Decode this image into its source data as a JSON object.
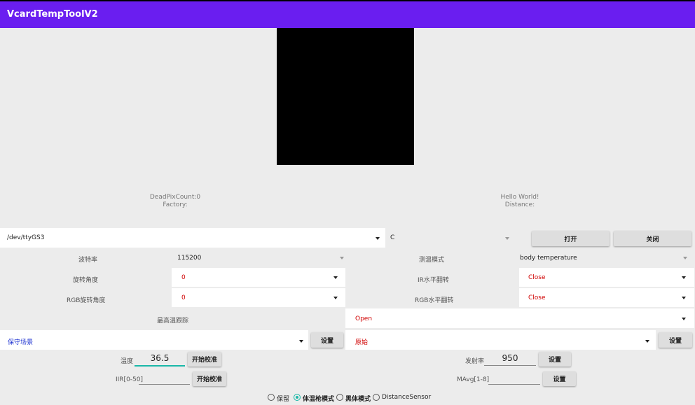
{
  "app": {
    "title": "VcardTempToolV2"
  },
  "status": {
    "dead_pix": "DeadPixCount:0",
    "factory": "Factory:",
    "hello": "Hello World!",
    "distance": "Distance:"
  },
  "serial": {
    "port": "/dev/ttyGS3",
    "unit": "C",
    "open_label": "打开",
    "close_label": "关闭"
  },
  "settings": {
    "baud_label": "波特率",
    "baud_value": "115200",
    "mode_label": "测温模式",
    "mode_value": "body temperature",
    "rotate_label": "旋转角度",
    "rotate_value": "0",
    "ir_flip_label": "IR水平翻转",
    "ir_flip_value": "Close",
    "rgb_rotate_label": "RGB旋转角度",
    "rgb_rotate_value": "0",
    "rgb_flip_label": "RGB水平翻转",
    "rgb_flip_value": "Close",
    "track_label": "最高温跟踪",
    "track_value": "Open"
  },
  "scene": {
    "value": "保守场景",
    "set_label": "设置"
  },
  "source": {
    "value": "原始",
    "set_label": "设置"
  },
  "calib": {
    "temp_label": "温度",
    "temp_value": "36.5",
    "start_label": "开始校准",
    "emis_label": "发射率",
    "emis_value": "950",
    "emis_set_label": "设置",
    "iir_label": "IIR[0-50]",
    "iir_start_label": "开始校准",
    "mavg_label": "MAvg[1-8]",
    "mavg_set_label": "设置"
  },
  "modes": [
    {
      "label": "保留",
      "selected": false
    },
    {
      "label": "体温枪模式",
      "selected": true
    },
    {
      "label": "黑体模式",
      "selected": false
    },
    {
      "label": "DistanceSensor",
      "selected": false
    }
  ],
  "colors": {
    "appbar": "#6a1ef0",
    "accent": "#1ab8a8",
    "red_value": "#d00000",
    "blue_value": "#1a2fd0"
  }
}
